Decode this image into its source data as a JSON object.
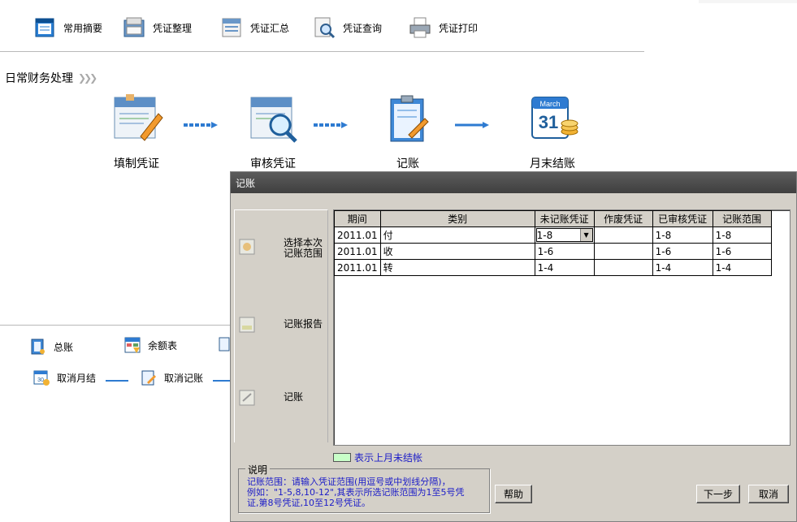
{
  "toolbar": {
    "items": [
      {
        "label": "常用摘要",
        "icon": "summary-icon"
      },
      {
        "label": "凭证整理",
        "icon": "voucher-organize-icon"
      },
      {
        "label": "凭证汇总",
        "icon": "voucher-summary-icon"
      },
      {
        "label": "凭证查询",
        "icon": "voucher-query-icon"
      },
      {
        "label": "凭证打印",
        "icon": "voucher-print-icon"
      }
    ]
  },
  "section": {
    "title": "日常财务处理"
  },
  "flow": {
    "items": [
      {
        "label": "填制凭证",
        "icon": "fill-voucher-icon"
      },
      {
        "label": "审核凭证",
        "icon": "audit-voucher-icon"
      },
      {
        "label": "记账",
        "icon": "post-ledger-icon"
      },
      {
        "label": "月末结账",
        "icon": "month-end-close-icon"
      }
    ]
  },
  "lower": {
    "items": [
      {
        "label": "总账"
      },
      {
        "label": "余额表"
      },
      {
        "label": "取消月结"
      },
      {
        "label": "取消记账"
      }
    ]
  },
  "dialog": {
    "title": "记账",
    "steps": [
      {
        "label": "选择本次记账范围",
        "line1": "选择本次",
        "line2": "记账范围"
      },
      {
        "label": "记账报告"
      },
      {
        "label": "记账"
      }
    ],
    "table": {
      "headers": [
        "期间",
        "类别",
        "未记账凭证",
        "作废凭证",
        "已审核凭证",
        "记账范围"
      ],
      "rows": [
        {
          "period": "2011.01",
          "category": "付",
          "unposted": "1-8",
          "voided": "",
          "audited": "1-8",
          "range": "1-8"
        },
        {
          "period": "2011.01",
          "category": "收",
          "unposted": "1-6",
          "voided": "",
          "audited": "1-6",
          "range": "1-6"
        },
        {
          "period": "2011.01",
          "category": "转",
          "unposted": "1-4",
          "voided": "",
          "audited": "1-4",
          "range": "1-4"
        }
      ]
    },
    "legend": {
      "text": "表示上月未结帐",
      "color": "#c8ffc8"
    },
    "note": {
      "title": "说明",
      "line1": "记账范围：请输入凭证范围(用逗号或中划线分隔)，",
      "line2": "例如：\"1-5,8,10-12\",其表示所选记账范围为1至5号凭",
      "line3": "证,第8号凭证,10至12号凭证。"
    },
    "buttons": {
      "help": "帮助",
      "next": "下一步",
      "cancel": "取消"
    }
  }
}
